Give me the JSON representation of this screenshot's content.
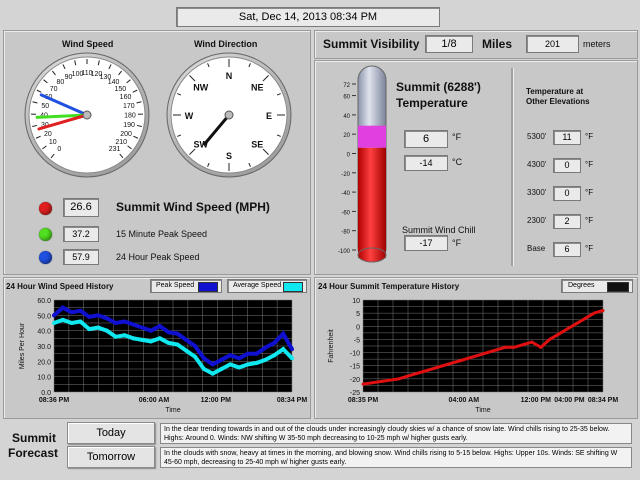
{
  "header": {
    "datetime": "Sat, Dec 14, 2013   08:34 PM"
  },
  "wind": {
    "speed_title": "Wind Speed",
    "direction_title": "Wind Direction",
    "speed_ticks": [
      "0",
      "10",
      "20",
      "30",
      "40",
      "50",
      "60",
      "70",
      "80",
      "90",
      "100",
      "110",
      "120",
      "130",
      "140",
      "150",
      "160",
      "170",
      "180",
      "190",
      "200",
      "210",
      "231"
    ],
    "compass": [
      "N",
      "NE",
      "E",
      "SE",
      "S",
      "SW",
      "W",
      "NW"
    ],
    "current_value": "26.6",
    "current_label": "Summit Wind Speed (MPH)",
    "peak15_value": "37.2",
    "peak15_label": "15 Minute Peak Speed",
    "peak24_value": "57.9",
    "peak24_label": "24 Hour Peak Speed",
    "colors": {
      "current": "#e02020",
      "peak15": "#40e020",
      "peak24": "#2050e0"
    }
  },
  "visibility": {
    "title": "Summit Visibility",
    "value": "1/8",
    "unit": "Miles",
    "meters": "201",
    "meters_unit": "meters"
  },
  "temperature": {
    "title_line1": "Summit (6288')",
    "title_line2": "Temperature",
    "fahrenheit": "6",
    "f_unit": "°F",
    "celsius": "-14",
    "c_unit": "°C",
    "windchill_label": "Summit Wind Chill",
    "windchill": "-17",
    "windchill_unit": "°F",
    "scale": [
      "72",
      "60",
      "40",
      "20",
      "0",
      "-20",
      "-40",
      "-60",
      "-80",
      "-100"
    ],
    "level_f": 6
  },
  "elevations": {
    "title_line1": "Temperature at",
    "title_line2": "Other Elevations",
    "rows": [
      {
        "label": "5300'",
        "value": "11",
        "unit": "°F"
      },
      {
        "label": "4300'",
        "value": "0",
        "unit": "°F"
      },
      {
        "label": "3300'",
        "value": "0",
        "unit": "°F"
      },
      {
        "label": "2300'",
        "value": "2",
        "unit": "°F"
      },
      {
        "label": "Base",
        "value": "6",
        "unit": "°F"
      }
    ]
  },
  "chart_data": [
    {
      "type": "line",
      "title": "24 Hour Wind Speed History",
      "xlabel": "Time",
      "ylabel": "Miles Per Hour",
      "x_ticks": [
        "08:36 PM",
        "06:00 AM",
        "12:00 PM",
        "08:34 PM"
      ],
      "y_ticks": [
        "0.0",
        "10.0",
        "20.0",
        "30.0",
        "40.0",
        "50.0",
        "60.0"
      ],
      "ylim": [
        0,
        60
      ],
      "grid": true,
      "legend": "top-right",
      "series": [
        {
          "name": "Peak Speed",
          "color": "#1010d0",
          "values": [
            50,
            55,
            52,
            53,
            49,
            50,
            48,
            45,
            46,
            44,
            42,
            40,
            43,
            39,
            38,
            34,
            30,
            22,
            18,
            21,
            24,
            22,
            25,
            25,
            29,
            32,
            38,
            28
          ]
        },
        {
          "name": "Average Speed",
          "color": "#10e8f0",
          "values": [
            45,
            47,
            45,
            46,
            41,
            42,
            40,
            36,
            37,
            35,
            34,
            33,
            35,
            32,
            31,
            27,
            23,
            15,
            12,
            15,
            18,
            16,
            18,
            19,
            21,
            24,
            28,
            22
          ]
        }
      ]
    },
    {
      "type": "line",
      "title": "24 Hour Summit Temperature History",
      "xlabel": "Time",
      "ylabel": "Fahrenheit",
      "x_ticks": [
        "08:35 PM",
        "04:00 AM",
        "12:00 PM",
        "04:00 PM",
        "08:34 PM"
      ],
      "y_ticks": [
        "-25",
        "-20",
        "-15",
        "-10",
        "-5",
        "0",
        "5",
        "10"
      ],
      "ylim": [
        -25,
        10
      ],
      "grid": true,
      "legend": "top-right",
      "series": [
        {
          "name": "Degrees",
          "color": "#e01010",
          "values": [
            -22,
            -21.5,
            -21,
            -20.5,
            -20,
            -19,
            -18,
            -17,
            -16,
            -15,
            -14,
            -13,
            -12,
            -11,
            -10,
            -9,
            -8,
            -8,
            -7,
            -6,
            -8,
            -5,
            -3,
            -1,
            1,
            3,
            5,
            6
          ]
        }
      ]
    }
  ],
  "forecast": {
    "title_line1": "Summit",
    "title_line2": "Forecast",
    "today_label": "Today",
    "today_text": "In the clear trending towards in and out of the clouds under increasingly cloudy skies w/ a chance of snow late. Wind chills rising to 25-35 below.  Highs: Around 0.  Winds: NW shifting W 35-50 mph decreasing to 10-25 mph w/ higher gusts early.",
    "tomorrow_label": "Tomorrow",
    "tomorrow_text": "In the clouds with snow, heavy at times in the morning, and blowing snow. Wind chills rising to 5-15 below.  Highs: Upper 10s.  Winds: SE shifting W 45-60 mph, decreasing to 25-40 mph w/ higher gusts early."
  }
}
